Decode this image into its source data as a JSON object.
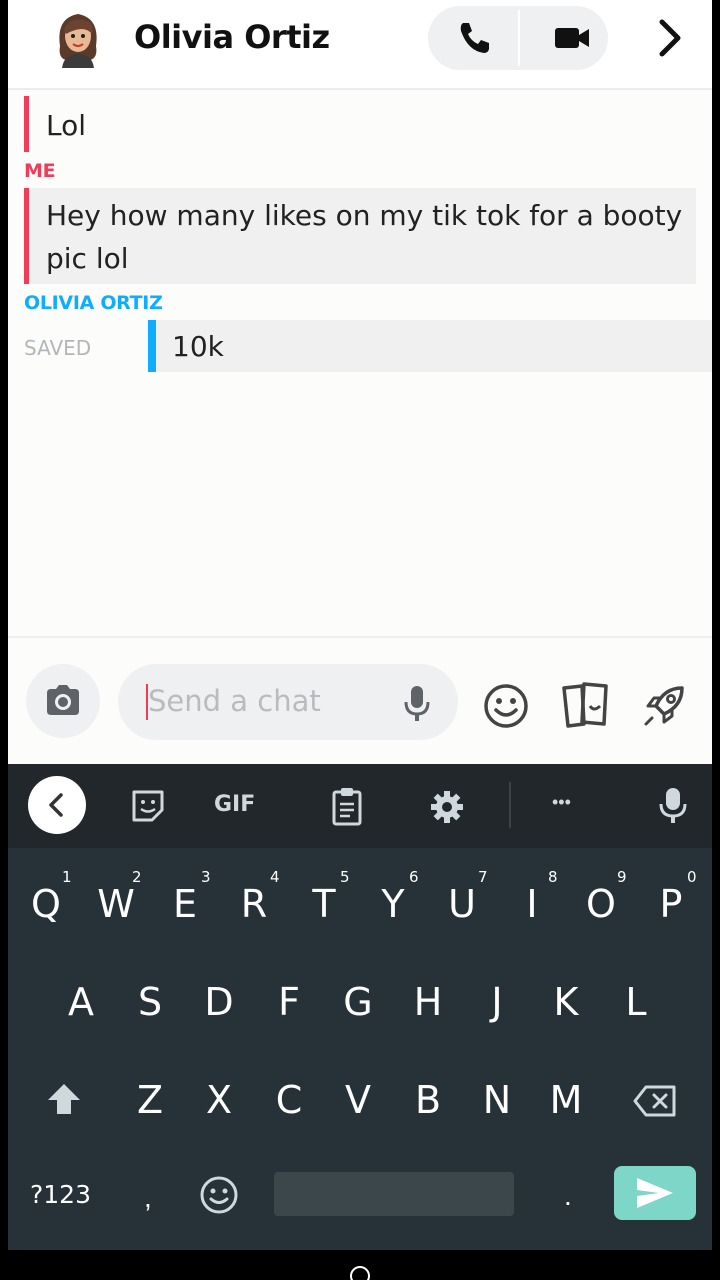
{
  "header": {
    "contact_name": "Olivia Ortiz",
    "icons": [
      "avatar",
      "phone-icon",
      "video-icon",
      "chevron-right-icon"
    ]
  },
  "messages": {
    "partial_top": "Lol",
    "me_label": "ME",
    "me_text_line1": "Hey how many likes on my tik tok for a booty",
    "me_text_line2": "pic lol",
    "friend_label": "OLIVIA ORTIZ",
    "saved_label": "SAVED",
    "friend_text": "10k"
  },
  "input": {
    "placeholder": "Send a chat",
    "icons": [
      "camera-icon",
      "mic-icon",
      "emoji-icon",
      "stickers-icon",
      "games-rocket-icon"
    ]
  },
  "keyboard": {
    "toolbar": {
      "gif_label": "GIF",
      "more_label": "•••"
    },
    "row1": [
      "Q",
      "W",
      "E",
      "R",
      "T",
      "Y",
      "U",
      "I",
      "O",
      "P"
    ],
    "row1_sup": [
      "1",
      "2",
      "3",
      "4",
      "5",
      "6",
      "7",
      "8",
      "9",
      "0"
    ],
    "row2": [
      "A",
      "S",
      "D",
      "F",
      "G",
      "H",
      "J",
      "K",
      "L"
    ],
    "row3": [
      "Z",
      "X",
      "C",
      "V",
      "B",
      "N",
      "M"
    ],
    "symbols_label": "?123",
    "comma": ",",
    "period": "."
  },
  "colors": {
    "me_accent": "#f23c57",
    "friend_accent": "#0fadff",
    "keyboard_bg": "#263238",
    "send_button": "#7ed6c8"
  }
}
